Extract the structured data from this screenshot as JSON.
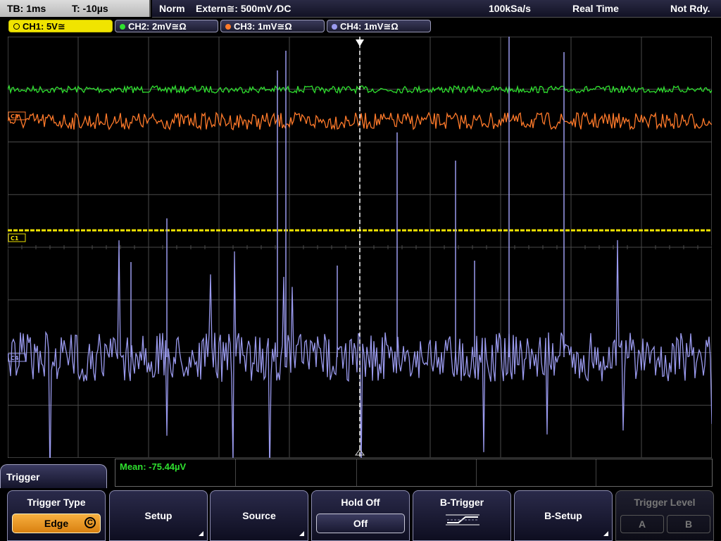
{
  "topbar": {
    "timebase": "TB: 1ms",
    "trigger_time": "T: -10µs",
    "mode": "Norm",
    "trigger_source": "Extern≅: 500mV ⁄DC",
    "sample_rate": "100kSa/s",
    "acq_mode": "Real Time",
    "status": "Not Rdy."
  },
  "channels": [
    {
      "label": "CH1: 5V≅",
      "color": "#f0e400",
      "active": true
    },
    {
      "label": "CH2: 2mV≅Ω",
      "color": "#2fe02f",
      "active": false
    },
    {
      "label": "CH3: 1mV≅Ω",
      "color": "#ff7a2a",
      "active": false
    },
    {
      "label": "CH4: 1mV≅Ω",
      "color": "#9a9aee",
      "active": false
    }
  ],
  "plot": {
    "channel_markers": [
      "C3",
      "C1",
      "C4"
    ],
    "colors": {
      "ch1": "#f0e400",
      "ch2": "#2fe02f",
      "ch3": "#ff7a2a",
      "ch4": "#9a9aee",
      "grid": "#4a4a4a",
      "trigger_line": "#ffffff"
    }
  },
  "measurement": {
    "text": "Mean: -75.44µV",
    "color": "#2fe02f"
  },
  "menu": {
    "title": "Trigger"
  },
  "softkeys": [
    {
      "label": "Trigger Type",
      "value": "Edge"
    },
    {
      "label": "Setup"
    },
    {
      "label": "Source"
    },
    {
      "label": "Hold Off",
      "value": "Off"
    },
    {
      "label": "B-Trigger"
    },
    {
      "label": "B-Setup"
    },
    {
      "label": "Trigger Level",
      "options": [
        "A",
        "B"
      ],
      "disabled": true
    }
  ]
}
